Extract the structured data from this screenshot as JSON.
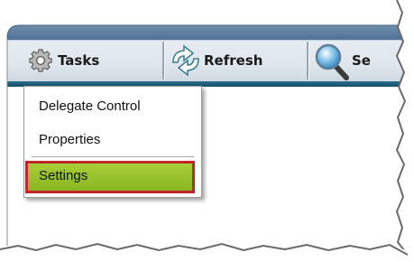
{
  "toolbar": {
    "items": [
      {
        "label": "Tasks",
        "icon": "gear-icon"
      },
      {
        "label": "Refresh",
        "icon": "refresh-icon"
      },
      {
        "label": "Se",
        "icon": "magnifier-icon"
      }
    ]
  },
  "menu": {
    "items": [
      {
        "label": "Delegate Control"
      },
      {
        "label": "Properties"
      },
      {
        "label": "Settings",
        "selected": true
      }
    ],
    "highlight_color": "#9cc631",
    "highlight_border": "#c0262c"
  },
  "colors": {
    "toolbar_top": "#4e7195",
    "toolbar_band": "#1f5e7a"
  }
}
